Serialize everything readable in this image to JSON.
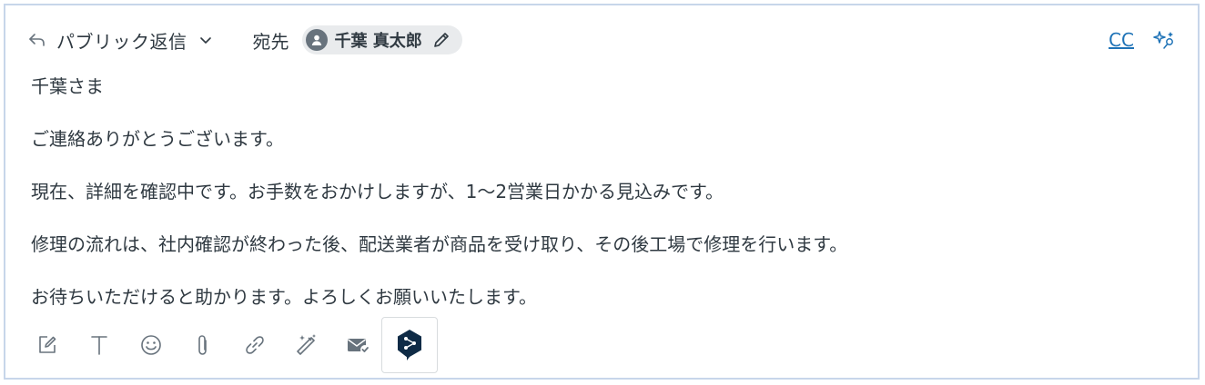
{
  "header": {
    "reply_type": "パブリック返信",
    "to_label": "宛先",
    "recipient_name": "千葉 真太郎",
    "cc_label": "CC"
  },
  "body": {
    "lines": [
      "千葉さま",
      "ご連絡ありがとうございます。",
      "現在、詳細を確認中です。お手数をおかけしますが、1〜2営業日かかる見込みです。",
      "修理の流れは、社内確認が終わった後、配送業者が商品を受け取り、その後工場で修理を行います。",
      "お待ちいただけると助かります。よろしくお願いいたします。"
    ]
  },
  "toolbar": {
    "icons": [
      "compose-icon",
      "text-format-icon",
      "emoji-icon",
      "attachment-icon",
      "link-icon",
      "magic-wand-icon",
      "email-check-icon",
      "deepl-icon"
    ]
  },
  "colors": {
    "text": "#2f3941",
    "link": "#1f73b7",
    "chip_bg": "#e9ebed",
    "frame_border": "#c7d6ea",
    "deepl_navy": "#0f2b46"
  }
}
